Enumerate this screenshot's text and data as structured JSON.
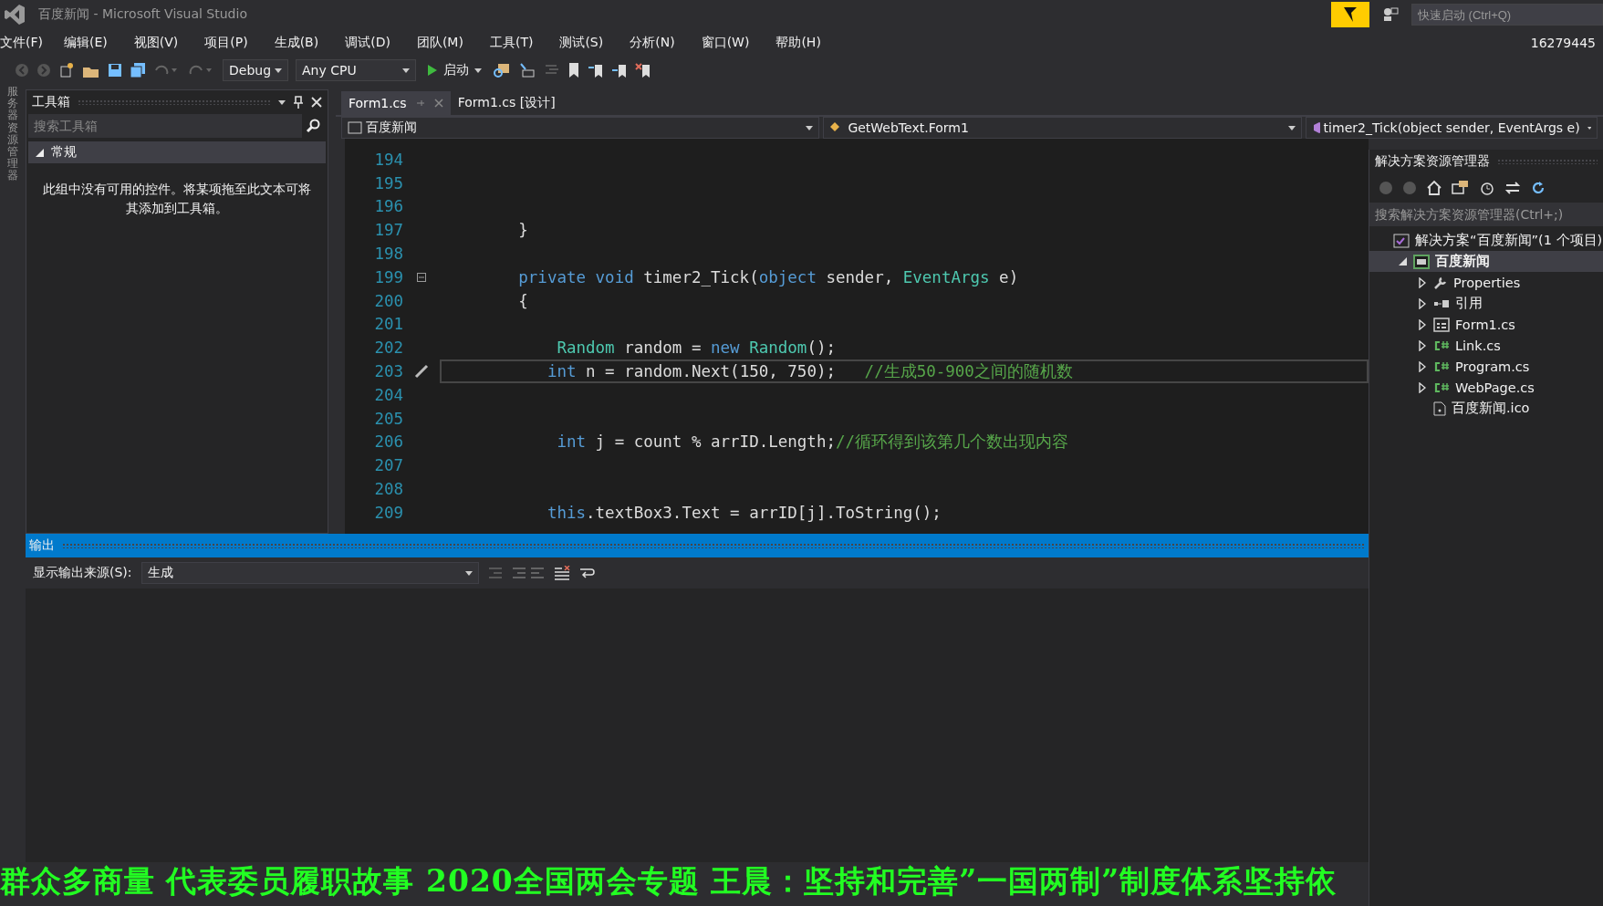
{
  "window": {
    "title": "百度新闻 - Microsoft Visual Studio",
    "quick_launch": {
      "placeholder": "快速启动 (Ctrl+Q)"
    },
    "account": "16279445"
  },
  "menu": [
    "文件(F)",
    "编辑(E)",
    "视图(V)",
    "项目(P)",
    "生成(B)",
    "调试(D)",
    "团队(M)",
    "工具(T)",
    "测试(S)",
    "分析(N)",
    "窗口(W)",
    "帮助(H)"
  ],
  "toolbar": {
    "configuration": "Debug",
    "platform": "Any CPU",
    "start": "启动"
  },
  "side_strip": "服务器资源管理器",
  "toolbox": {
    "title": "工具箱",
    "search": {
      "placeholder": "搜索工具箱"
    },
    "group": {
      "label": "常规",
      "expanded": true
    },
    "empty_text": "此组中没有可用的控件。将某项拖至此文本可将其添加到工具箱。"
  },
  "editor": {
    "tabs": [
      {
        "label": "Form1.cs",
        "selected": true
      },
      {
        "label": "Form1.cs [设计]",
        "selected": false
      }
    ],
    "nav": [
      "百度新闻",
      "GetWebText.Form1",
      "timer2_Tick(object sender, EventArgs e)"
    ],
    "lines": [
      {
        "number": "194",
        "current": false
      },
      {
        "number": "195",
        "current": false
      },
      {
        "number": "196",
        "current": false
      },
      {
        "number": "197",
        "current": false,
        "tokens": [
          {
            "text": "        }",
            "kind": "plain"
          }
        ]
      },
      {
        "number": "198",
        "current": false
      },
      {
        "number": "199",
        "current": false,
        "fold": true,
        "tokens": [
          {
            "text": "        private void ",
            "kind": "keyword"
          },
          {
            "text": "timer2_Tick(",
            "kind": "plain"
          },
          {
            "text": "object",
            "kind": "keyword"
          },
          {
            "text": " sender, ",
            "kind": "plain"
          },
          {
            "text": "EventArgs",
            "kind": "type"
          },
          {
            "text": " e)",
            "kind": "plain"
          }
        ]
      },
      {
        "number": "200",
        "current": false,
        "tokens": [
          {
            "text": "        {",
            "kind": "plain"
          }
        ]
      },
      {
        "number": "201",
        "current": false
      },
      {
        "number": "202",
        "current": false,
        "tokens": [
          {
            "text": "            Random",
            "kind": "type"
          },
          {
            "text": " random = ",
            "kind": "plain"
          },
          {
            "text": "new ",
            "kind": "keyword"
          },
          {
            "text": "Random",
            "kind": "type"
          },
          {
            "text": "();",
            "kind": "plain"
          }
        ]
      },
      {
        "number": "203",
        "current": true,
        "tokens": [
          {
            "text": "           int",
            "kind": "keyword"
          },
          {
            "text": " n = random.Next(150, 750);   ",
            "kind": "plain"
          },
          {
            "text": "//生成50-900之间的随机数",
            "kind": "comment"
          }
        ]
      },
      {
        "number": "204",
        "current": false
      },
      {
        "number": "205",
        "current": false
      },
      {
        "number": "206",
        "current": false,
        "tokens": [
          {
            "text": "            int",
            "kind": "keyword"
          },
          {
            "text": " j = count % arrID.Length;",
            "kind": "plain"
          },
          {
            "text": "//循环得到该第几个数出现内容",
            "kind": "comment"
          }
        ]
      },
      {
        "number": "207",
        "current": false
      },
      {
        "number": "208",
        "current": false
      },
      {
        "number": "209",
        "current": false,
        "tokens": [
          {
            "text": "           this",
            "kind": "keyword"
          },
          {
            "text": ".textBox3.Text = arrID[j].ToString();",
            "kind": "plain"
          }
        ]
      }
    ]
  },
  "solution_explorer": {
    "title": "解决方案资源管理器",
    "search": {
      "placeholder": "搜索解决方案资源管理器(Ctrl+;)"
    },
    "tree": [
      {
        "label": "解决方案“百度新闻”(1 个项目)",
        "kind": "solution",
        "selected": false,
        "children": [
          {
            "label": "百度新闻",
            "kind": "project",
            "selected": true,
            "expanded": true,
            "children": [
              {
                "label": "Properties",
                "kind": "wrench",
                "selected": false,
                "expanded": false
              },
              {
                "label": "引用",
                "kind": "references",
                "selected": false,
                "expanded": false
              },
              {
                "label": "Form1.cs",
                "kind": "form",
                "selected": false,
                "expanded": false
              },
              {
                "label": "Link.cs",
                "kind": "csharp",
                "selected": false,
                "expanded": false
              },
              {
                "label": "Program.cs",
                "kind": "csharp",
                "selected": false,
                "expanded": false
              },
              {
                "label": "WebPage.cs",
                "kind": "csharp",
                "selected": false,
                "expanded": false
              },
              {
                "label": "百度新闻.ico",
                "kind": "file",
                "selected": false
              }
            ]
          }
        ]
      }
    ]
  },
  "output": {
    "title": "输出",
    "source_label": "显示输出来源(S):",
    "source": "生成"
  },
  "ticker": "群众多商量 代表委员履职故事 2020全国两会专题 王晨：坚持和完善”一国两制”制度体系坚持依"
}
